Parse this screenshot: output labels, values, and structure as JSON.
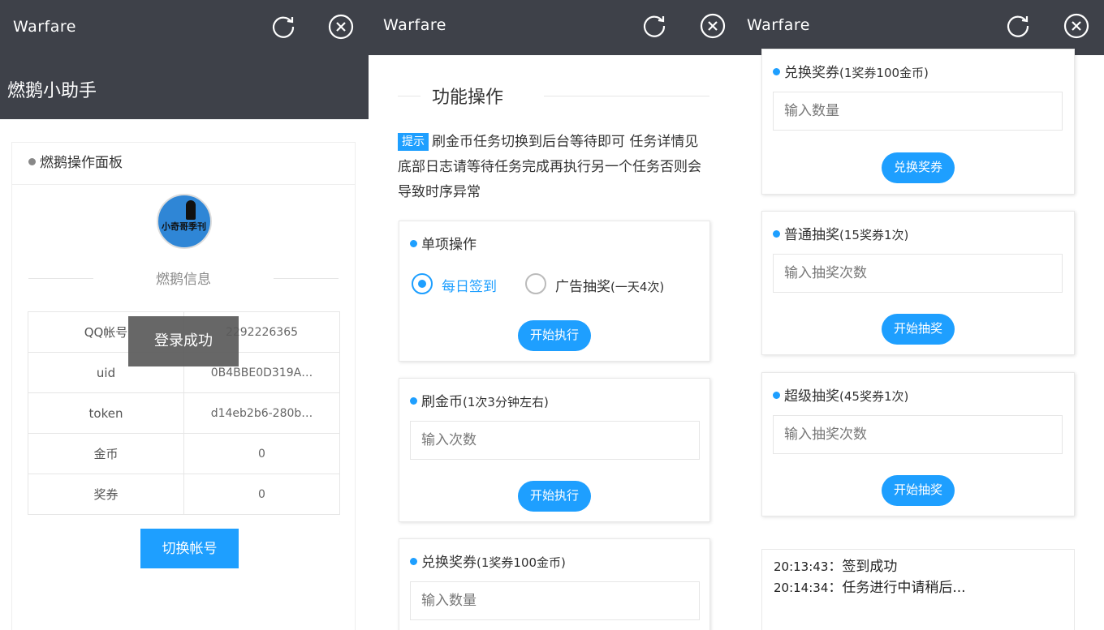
{
  "window": {
    "title": "Warfare",
    "refresh_icon": "refresh-icon",
    "close_icon": "close-icon"
  },
  "panel1": {
    "header": "燃鹅小助手",
    "card_title": "燃鹅操作面板",
    "avatar_text": "小奇哥季刊",
    "info_title": "燃鹅信息",
    "rows": [
      {
        "label": "QQ帐号",
        "value": "2292226365"
      },
      {
        "label": "uid",
        "value": "0B4BBE0D319A…"
      },
      {
        "label": "token",
        "value": "d14eb2b6-280b…"
      },
      {
        "label": "金币",
        "value": "0"
      },
      {
        "label": "奖券",
        "value": "0"
      }
    ],
    "switch_button": "切换帐号",
    "toast": "登录成功"
  },
  "panel2": {
    "section_title": "功能操作",
    "tip_badge": "提示",
    "tip_text": "刷金币任务切换到后台等待即可 任务详情见底部日志请等待任务完成再执行另一个任务否则会导致时序异常",
    "single_op": {
      "title": "单项操作",
      "options": [
        {
          "label": "每日签到",
          "sub": "",
          "selected": true
        },
        {
          "label": "广告抽奖",
          "sub": "(一天4次)",
          "selected": false
        }
      ],
      "button": "开始执行"
    },
    "coins": {
      "title": "刷金币",
      "sub": "(1次3分钟左右)",
      "placeholder": "输入次数",
      "button": "开始执行"
    },
    "exchange": {
      "title": "兑换奖券",
      "sub": "(1奖券100金币)",
      "placeholder": "输入数量"
    }
  },
  "panel3": {
    "exchange": {
      "title": "兑换奖券",
      "sub": "(1奖券100金币)",
      "placeholder": "输入数量",
      "button": "兑换奖券"
    },
    "normal_draw": {
      "title": "普通抽奖",
      "sub": "(15奖券1次)",
      "placeholder": "输入抽奖次数",
      "button": "开始抽奖"
    },
    "super_draw": {
      "title": "超级抽奖",
      "sub": "(45奖券1次)",
      "placeholder": "输入抽奖次数",
      "button": "开始抽奖"
    },
    "log": [
      {
        "time": "20:13:43",
        "text": "签到成功"
      },
      {
        "time": "20:14:34",
        "text": "任务进行中请稍后..."
      }
    ]
  },
  "colors": {
    "topbar": "#3e4149",
    "accent": "#1e9fff",
    "toast": "#5a5a5a"
  }
}
